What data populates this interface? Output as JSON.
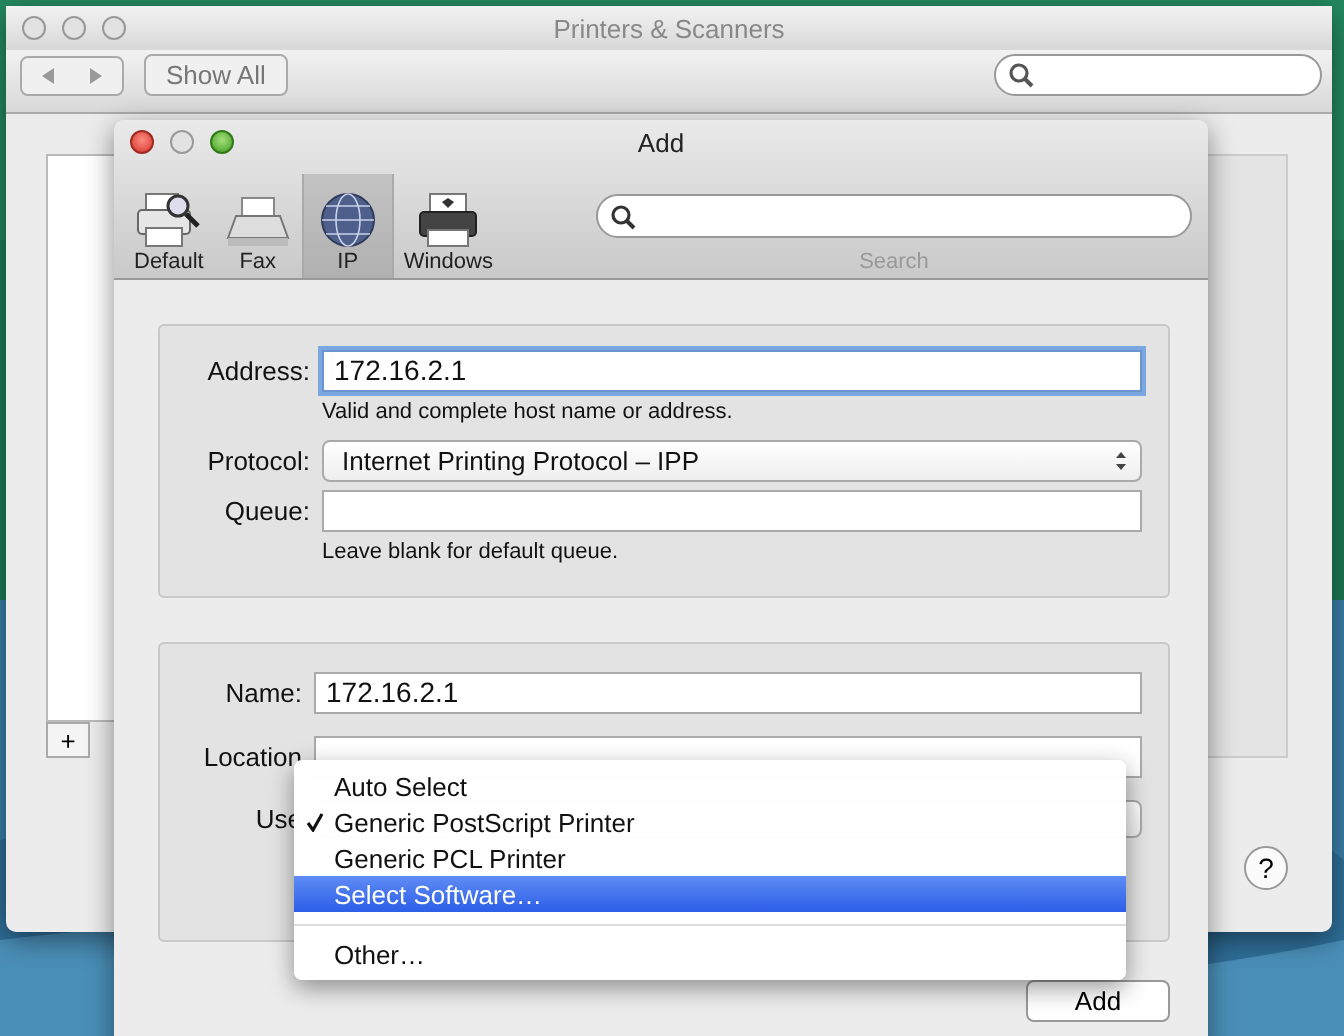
{
  "background_window": {
    "title": "Printers & Scanners",
    "show_all": "Show All",
    "list_buttons": [
      "+"
    ],
    "help": "?"
  },
  "dialog": {
    "title": "Add",
    "toolbar": [
      {
        "label": "Default",
        "kind": "default",
        "selected": false
      },
      {
        "label": "Fax",
        "kind": "fax",
        "selected": false
      },
      {
        "label": "IP",
        "kind": "ip",
        "selected": true
      },
      {
        "label": "Windows",
        "kind": "windows",
        "selected": false
      }
    ],
    "search": {
      "label": "Search"
    },
    "connection_fields": [
      {
        "label": "Address:",
        "kind": "text",
        "value": "172.16.2.1",
        "focused": true,
        "hint": "Valid and complete host name or address."
      },
      {
        "label": "Protocol:",
        "kind": "popup",
        "value": "Internet Printing Protocol – IPP",
        "focused": false
      },
      {
        "label": "Queue:",
        "kind": "text",
        "focused": false,
        "hint": "Leave blank for default queue."
      }
    ],
    "printer_fields": [
      {
        "label": "Name:",
        "kind": "text",
        "value": "172.16.2.1"
      },
      {
        "label": "Location",
        "kind": "text"
      },
      {
        "label": "Use",
        "kind": "popup"
      }
    ],
    "add_button": "Add"
  },
  "menu": {
    "items": [
      {
        "kind": "item",
        "label": "Auto Select",
        "checked": false,
        "selected": false
      },
      {
        "kind": "item",
        "label": "Generic PostScript Printer",
        "checked": true,
        "selected": false
      },
      {
        "kind": "item",
        "label": "Generic PCL Printer",
        "checked": false,
        "selected": false
      },
      {
        "kind": "item",
        "label": "Select Software…",
        "checked": false,
        "selected": true
      },
      {
        "kind": "separator"
      },
      {
        "kind": "item",
        "label": "Other…",
        "checked": false,
        "selected": false
      }
    ]
  }
}
